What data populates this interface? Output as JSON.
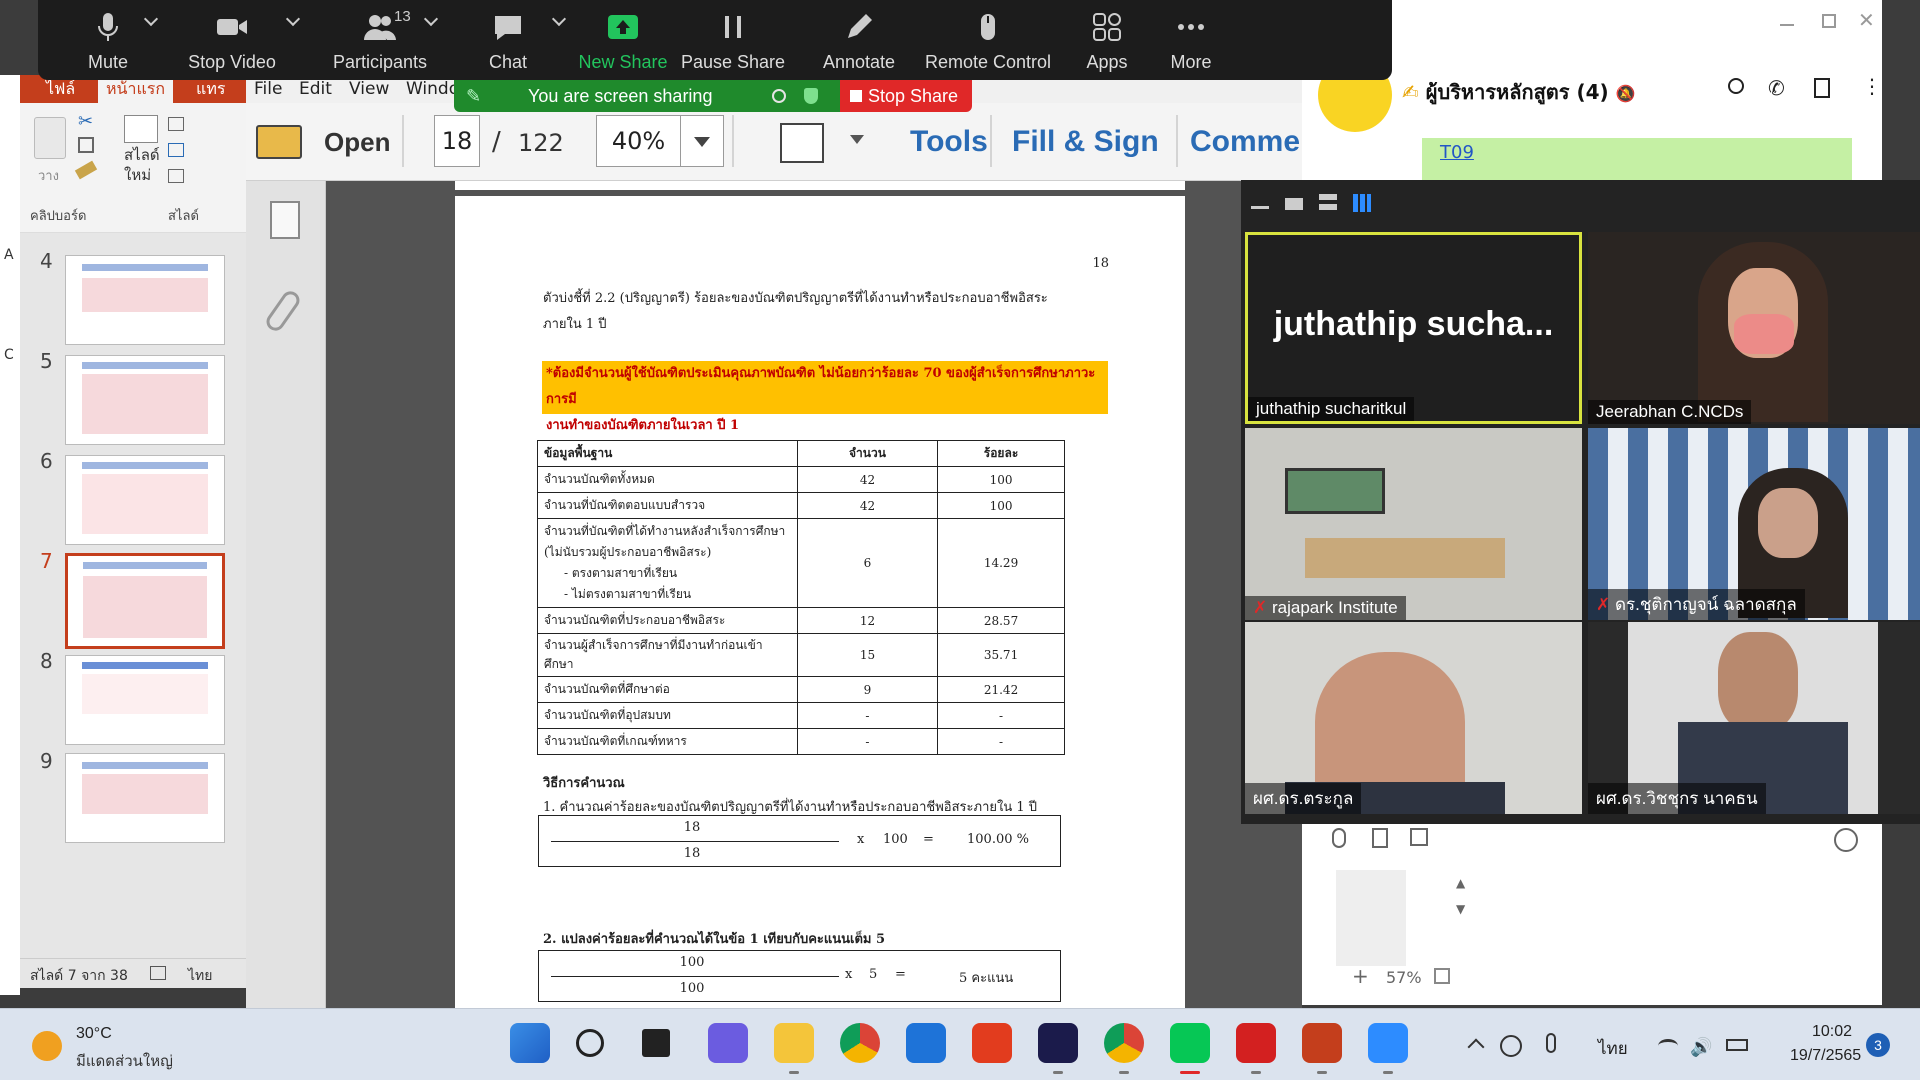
{
  "zoom": {
    "controls": [
      {
        "label": "Mute",
        "icon": "microphone-icon"
      },
      {
        "label": "Stop Video",
        "icon": "video-camera-icon"
      },
      {
        "label": "Participants",
        "icon": "participants-icon",
        "count": "13"
      },
      {
        "label": "Chat",
        "icon": "chat-bubble-icon"
      },
      {
        "label": "New Share",
        "icon": "share-screen-icon"
      },
      {
        "label": "Pause Share",
        "icon": "pause-icon"
      },
      {
        "label": "Annotate",
        "icon": "pencil-icon"
      },
      {
        "label": "Remote Control",
        "icon": "mouse-icon"
      },
      {
        "label": "Apps",
        "icon": "apps-icon"
      },
      {
        "label": "More",
        "icon": "more-dots-icon"
      }
    ],
    "banner_text": "You are screen sharing",
    "stop_share_label": "Stop Share",
    "gallery": [
      {
        "name": "juthathip sucharitkul",
        "big_name": "juthathip  sucha...",
        "speaking": true,
        "muted": false
      },
      {
        "name": "Jeerabhan C.NCDs",
        "speaking": false,
        "muted": false
      },
      {
        "name": "rajapark Institute",
        "speaking": false,
        "muted": true
      },
      {
        "name": "ดร.ชุติกาญจน์ ฉลาดสกุล",
        "speaking": false,
        "muted": true
      },
      {
        "name": "ผศ.ดร.ตระกูล",
        "speaking": false,
        "muted": false
      },
      {
        "name": "ผศ.ดร.วิชชุกร นาคธน",
        "speaking": false,
        "muted": false
      }
    ],
    "accent": "#22c45d",
    "speaker_border": "#d8e33f"
  },
  "acrobat": {
    "menu": [
      "File",
      "Edit",
      "View",
      "Windo"
    ],
    "open_label": "Open",
    "page_current": "18",
    "page_sep": "/",
    "page_total": "122",
    "zoom": "40%",
    "tools": [
      "Tools",
      "Fill & Sign",
      "Commer"
    ]
  },
  "ppt": {
    "tabs": [
      "ไฟล์",
      "หน้าแรก",
      "แทร"
    ],
    "ribbon": {
      "paste": "วาง",
      "new_slide": "สไลด์\nใหม่",
      "clipboard": "คลิปบอร์ด",
      "slides_group": "สไลด์"
    },
    "thumb_numbers": [
      "4",
      "5",
      "6",
      "7",
      "8",
      "9"
    ],
    "status_slide": "สไลด์ 7 จาก 38",
    "status_lang": "ไทย",
    "left_letters": [
      "A",
      "C"
    ]
  },
  "pdf": {
    "page_number": "18",
    "caption_line1": "ตัวบ่งชี้ที่ 2.2 (ปริญญาตรี) ร้อยละของบัณฑิตปริญญาตรีที่ได้งานทำหรือประกอบอาชีพอิสระ",
    "caption_line2": "ภายใน 1 ปี",
    "note_line1": "*ต้องมีจำนวนผู้ใช้บัณฑิตประเมินคุณภาพบัณฑิต ไม่น้อยกว่าร้อยละ 70 ของผู้สำเร็จการศึกษาภาวะการมี",
    "note_line2": "งานทำของบัณฑิตภายในเวลา ปี 1",
    "table_headers": [
      "ข้อมูลพื้นฐาน",
      "จำนวน",
      "ร้อยละ"
    ],
    "table_rows": [
      {
        "label": "จำนวนบัณฑิตทั้งหมด",
        "count": "42",
        "percent": "100"
      },
      {
        "label": "จำนวนที่บัณฑิตตอบแบบสำรวจ",
        "count": "42",
        "percent": "100"
      },
      {
        "label": "จำนวนที่บัณฑิตที่ได้ทำงานหลังสำเร็จการศึกษา",
        "label2": "(ไม่นับรวมผู้ประกอบอาชีพอิสระ)",
        "label3": "-    ตรงตามสาขาที่เรียน",
        "label4": "-    ไม่ตรงตามสาขาที่เรียน",
        "count": "6",
        "percent": "14.29"
      },
      {
        "label": "จำนวนบัณฑิตที่ประกอบอาชีพอิสระ",
        "count": "12",
        "percent": "28.57"
      },
      {
        "label": "จำนวนผู้สำเร็จการศึกษาที่มีงานทำก่อนเข้าศึกษา",
        "count": "15",
        "percent": "35.71"
      },
      {
        "label": "จำนวนบัณฑิตที่ศึกษาต่อ",
        "count": "9",
        "percent": "21.42"
      },
      {
        "label": "จำนวนบัณฑิตที่อุปสมบท",
        "count": "-",
        "percent": "-"
      },
      {
        "label": "จำนวนบัณฑิตที่เกณฑ์ทหาร",
        "count": "-",
        "percent": "-"
      }
    ],
    "calc_title": "วิธีการคำนวณ",
    "calc_step1": "1. คำนวณค่าร้อยละของบัณฑิตปริญญาตรีที่ได้งานทำหรือประกอบอาชีพอิสระภายใน 1 ปี",
    "calc1": {
      "num": "18",
      "den": "18",
      "op": "x",
      "mult": "100",
      "eq": "=",
      "result": "100.00 %"
    },
    "calc_step2": "2. แปลงค่าร้อยละที่คำนวณได้ในข้อ 1 เทียบกับคะแนนเต็ม 5",
    "calc2": {
      "num": "100",
      "den": "100",
      "op": "x",
      "mult": "5",
      "eq": "=",
      "result": "5 คะแนน"
    }
  },
  "line": {
    "chat_title": "ผู้บริหารหลักสูตร (4)",
    "bubble_text": "T09",
    "zoom_level": "57%",
    "bubble_color": "#c5f0a4"
  },
  "taskbar": {
    "temp": "30°C",
    "weather": "มีแดดส่วนใหญ่",
    "lang": "ไทย",
    "time": "10:02",
    "date": "19/7/2565",
    "notif_count": "3",
    "apps": [
      "windows-start-icon",
      "search-icon",
      "task-view-icon",
      "teams-chat-icon",
      "file-explorer-icon",
      "chrome-icon",
      "mail-icon",
      "office-icon",
      "webex-icon",
      "chrome-profile-icon",
      "line-icon",
      "acrobat-icon",
      "powerpoint-icon",
      "zoom-icon"
    ]
  }
}
